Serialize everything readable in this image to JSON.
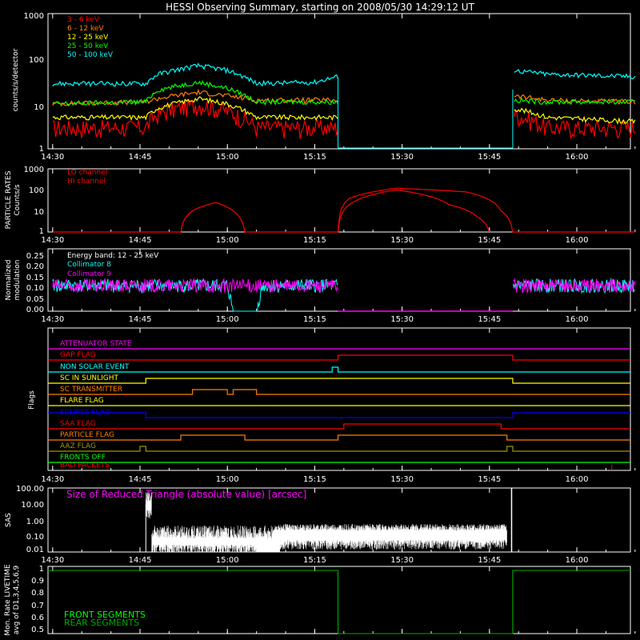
{
  "title": "HESSI Observing Summary, starting on 2008/05/30 14:29:12 UT",
  "colors": {
    "background": "#000000",
    "axes": "#ffffff",
    "red": "#ff0000",
    "orange": "#ff7f00",
    "yellow": "#ffff00",
    "green": "#00ff00",
    "cyan": "#00ffff",
    "magenta": "#ff00ff",
    "blue": "#0000ff",
    "darkgreen": "#00aa00",
    "olive": "#9a9a00"
  },
  "time_ticks": [
    "14:30",
    "14:45",
    "15:00",
    "15:15",
    "15:30",
    "15:45",
    "16:00"
  ],
  "panels": {
    "counts": {
      "ylabel": "counts/s/detector",
      "yticks": [
        "1",
        "10",
        "100",
        "1000"
      ],
      "legend": [
        "3 - 6 keV",
        "6 - 12 keV",
        "12 - 25 keV",
        "25 - 50 keV",
        "50 - 100 keV"
      ]
    },
    "particle": {
      "ylabel": "PARTICLE RATES",
      "ylabel2": "Counts/s",
      "yticks": [
        "1",
        "10",
        "100",
        "1000"
      ],
      "legend": [
        "LO channel",
        "HI channel"
      ]
    },
    "modulation": {
      "ylabel": "Normalized",
      "ylabel2": "modulation",
      "yticks": [
        "0.00",
        "0.05",
        "0.10",
        "0.15",
        "0.20",
        "0.25"
      ],
      "legend": [
        "Energy band: 12 - 25 keV",
        "Collimator 8",
        "Collimator 9"
      ]
    },
    "flags": {
      "ylabel": "Flags",
      "names": [
        "ATTENUATOR STATE",
        "GAP FLAG",
        "NON SOLAR EVENT",
        "SC IN SUNLIGHT",
        "SC TRANSMITTER",
        "FLARE FLAG",
        "ECLIPSE FLAG",
        "SAA FLAG",
        "PARTICLE FLAG",
        "AAZ FLAG",
        "FRONTS OFF",
        "BAD PACKETS"
      ]
    },
    "sas": {
      "ylabel": "SAS",
      "yticks": [
        "0.01",
        "0.10",
        "1.00",
        "10.00",
        "100.00"
      ],
      "annotation": "Size of Reduced Triangle (absolute value) [arcsec]"
    },
    "livetime": {
      "ylabel": "Mon. Rate LIVETIME",
      "ylabel2": "avg of D1,3,4,5,6,9",
      "yticks": [
        "0.5",
        "0.6",
        "0.7",
        "0.8",
        "0.9",
        "1"
      ],
      "legend": [
        "FRONT SEGMENTS",
        "REAR SEGMENTS"
      ]
    }
  },
  "chart_data": [
    {
      "type": "line",
      "ylabel": "counts/s/detector",
      "yscale": "log",
      "ylim": [
        1,
        1000
      ],
      "x_range": [
        "14:30",
        "16:10"
      ],
      "series": [
        {
          "name": "3 - 6 keV",
          "color": "#ff0000",
          "x": [
            "14:30",
            "14:46",
            "14:48",
            "14:55",
            "15:00",
            "15:05",
            "15:15",
            "15:19",
            "15:45",
            "15:49",
            "15:55",
            "16:10"
          ],
          "values": [
            3,
            3,
            6,
            10,
            7,
            3,
            3,
            3,
            null,
            6,
            3,
            3
          ]
        },
        {
          "name": "6 - 12 keV",
          "color": "#ff7f00",
          "x": [
            "14:30",
            "14:46",
            "14:48",
            "14:55",
            "15:00",
            "15:05",
            "15:15",
            "15:19",
            "15:45",
            "15:49",
            "15:55",
            "16:10"
          ],
          "values": [
            10,
            11,
            13,
            18,
            15,
            12,
            12,
            12,
            null,
            15,
            12,
            11
          ]
        },
        {
          "name": "12 - 25 keV",
          "color": "#ffff00",
          "x": [
            "14:30",
            "14:46",
            "14:48",
            "14:55",
            "15:00",
            "15:05",
            "15:15",
            "15:19",
            "15:45",
            "15:49",
            "15:55",
            "16:10"
          ],
          "values": [
            5,
            5,
            8,
            13,
            10,
            5,
            5,
            5,
            null,
            8,
            5,
            4
          ]
        },
        {
          "name": "25 - 50 keV",
          "color": "#00ff00",
          "x": [
            "14:30",
            "14:46",
            "14:48",
            "14:55",
            "15:00",
            "15:05",
            "15:15",
            "15:19",
            "15:45",
            "15:49",
            "15:55",
            "16:10"
          ],
          "values": [
            10,
            11,
            20,
            30,
            22,
            11,
            11,
            11,
            null,
            12,
            11,
            11
          ]
        },
        {
          "name": "50 - 100 keV",
          "color": "#00ffff",
          "x": [
            "14:30",
            "14:46",
            "14:48",
            "14:55",
            "15:00",
            "15:05",
            "15:15",
            "15:19",
            "15:45",
            "15:49",
            "15:55",
            "16:10"
          ],
          "values": [
            28,
            28,
            45,
            70,
            55,
            28,
            30,
            40,
            null,
            55,
            45,
            40
          ]
        }
      ]
    },
    {
      "type": "line",
      "ylabel": "PARTICLE RATES Counts/s",
      "yscale": "log",
      "ylim": [
        1,
        1000
      ],
      "series": [
        {
          "name": "LO channel",
          "color": "#ff0000",
          "x": [
            "14:30",
            "14:52",
            "14:54",
            "14:58",
            "15:01",
            "15:03",
            "15:19",
            "15:21",
            "15:29",
            "15:41",
            "15:47",
            "15:49",
            "16:10"
          ],
          "values": [
            1,
            1,
            10,
            25,
            10,
            1,
            1,
            40,
            120,
            80,
            10,
            1,
            1
          ]
        },
        {
          "name": "HI channel",
          "color": "#ff0000",
          "x": [
            "15:19",
            "15:22",
            "15:29",
            "15:38",
            "15:43",
            "15:45"
          ],
          "values": [
            1,
            30,
            100,
            20,
            5,
            1
          ]
        }
      ]
    },
    {
      "type": "line",
      "ylabel": "Normalized modulation",
      "ylim": [
        0,
        0.27
      ],
      "series": [
        {
          "name": "Collimator 8",
          "color": "#00ffff",
          "x": [
            "14:30",
            "15:00",
            "15:01",
            "15:05",
            "15:06",
            "15:19",
            "15:45",
            "15:49",
            "16:10"
          ],
          "values": [
            0.11,
            0.11,
            0.0,
            0.0,
            0.11,
            0.11,
            null,
            0.11,
            0.11
          ]
        },
        {
          "name": "Collimator 9",
          "color": "#ff00ff",
          "x": [
            "14:30",
            "15:19",
            "15:45",
            "15:49",
            "16:10"
          ],
          "values": [
            0.11,
            0.11,
            null,
            0.11,
            0.11
          ]
        }
      ]
    },
    {
      "type": "line",
      "ylabel": "SAS",
      "yscale": "log",
      "ylim": [
        0.01,
        100
      ],
      "series": [
        {
          "name": "Size of Reduced Triangle",
          "color": "#ffffff",
          "x": [
            "14:46",
            "14:47",
            "15:05",
            "15:08",
            "15:48",
            "15:49"
          ],
          "values": [
            50,
            0.3,
            0.15,
            0.3,
            0.5,
            100
          ]
        }
      ]
    },
    {
      "type": "line",
      "ylabel": "Mon. Rate LIVETIME avg of D1,3,4,5,6,9",
      "ylim": [
        0.5,
        1
      ],
      "series": [
        {
          "name": "FRONT SEGMENTS",
          "color": "#00ff00",
          "x": [
            "14:30",
            "15:19",
            "15:49",
            "16:10"
          ],
          "values": [
            0.97,
            0.97,
            0.97,
            0.97
          ]
        },
        {
          "name": "REAR SEGMENTS",
          "color": "#00aa00",
          "x": [
            "14:30",
            "15:19",
            "15:49",
            "16:10"
          ],
          "values": [
            0.97,
            0.97,
            0.97,
            0.97
          ]
        }
      ]
    }
  ]
}
